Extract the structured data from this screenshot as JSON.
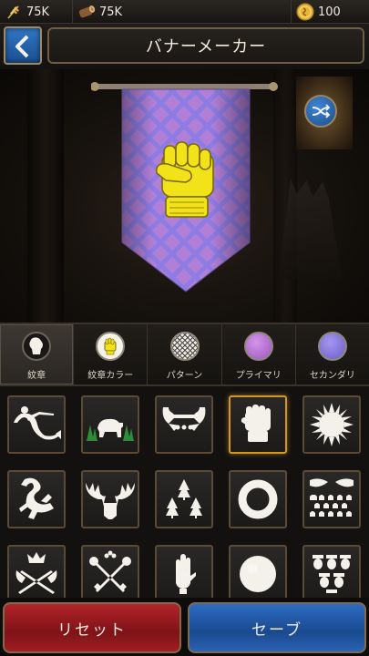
{
  "resources": {
    "wheat": {
      "icon": "wheat-icon",
      "value": "75K"
    },
    "wood": {
      "icon": "wood-log-icon",
      "value": "75K"
    },
    "gold": {
      "icon": "gold-coin-icon",
      "value": "100"
    }
  },
  "header": {
    "title": "バナーメーカー",
    "back_icon": "back-arrow-icon"
  },
  "preview": {
    "banner_pattern": "diagonal-lattice",
    "primary_color": "#b27fd6",
    "secondary_color": "#8d7ce4",
    "sigil": "fist",
    "sigil_color": "#f2e21a",
    "shuffle_icon": "shuffle-icon"
  },
  "tabs": [
    {
      "label": "紋章",
      "icon": "sigil-icon",
      "active": true
    },
    {
      "label": "紋章カラー",
      "icon": "sigil-color-swatch",
      "color": "#f2e21a",
      "active": false
    },
    {
      "label": "パターン",
      "icon": "pattern-swatch",
      "active": false
    },
    {
      "label": "プライマリ",
      "icon": "primary-color-swatch",
      "color": "#b86fd0",
      "active": false
    },
    {
      "label": "セカンダリ",
      "icon": "secondary-color-swatch",
      "color": "#7f6fd8",
      "active": false
    }
  ],
  "sigils": [
    {
      "name": "merman-sigil",
      "selected": false
    },
    {
      "name": "bear-sigil",
      "selected": false
    },
    {
      "name": "double-axes-sigil",
      "selected": false
    },
    {
      "name": "fist-sigil",
      "selected": true
    },
    {
      "name": "sun-sigil",
      "selected": false
    },
    {
      "name": "lizard-sigil",
      "selected": false
    },
    {
      "name": "moose-sigil",
      "selected": false
    },
    {
      "name": "three-trees-sigil",
      "selected": false
    },
    {
      "name": "ring-sigil",
      "selected": false
    },
    {
      "name": "waves-sigil",
      "selected": false
    },
    {
      "name": "crown-axes-sigil",
      "selected": false
    },
    {
      "name": "crossed-keys-sigil",
      "selected": false
    },
    {
      "name": "hand-sigil",
      "selected": false
    },
    {
      "name": "moon-sigil",
      "selected": false
    },
    {
      "name": "acorns-sigil",
      "selected": false
    }
  ],
  "buttons": {
    "reset_label": "リセット",
    "save_label": "セーブ"
  }
}
